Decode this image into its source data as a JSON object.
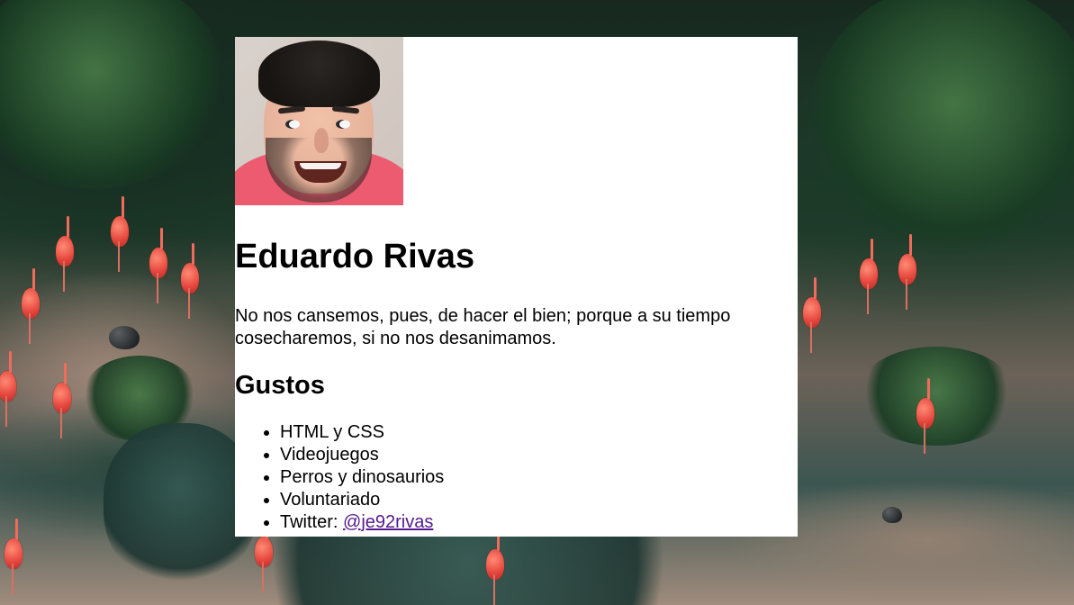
{
  "profile": {
    "name": "Eduardo Rivas",
    "quote": "No nos cansemos, pues, de hacer el bien; porque a su tiempo cosecharemos, si no nos desanimamos.",
    "likes_title": "Gustos",
    "likes": [
      "HTML y CSS",
      "Videojuegos",
      "Perros y dinosaurios",
      "Voluntariado"
    ],
    "twitter_label": "Twitter: ",
    "twitter_handle": "@je92rivas"
  },
  "colors": {
    "card_background": "#ffffff",
    "text": "#000000",
    "visited_link": "#551a8b",
    "shirt": "#ec5b70"
  }
}
